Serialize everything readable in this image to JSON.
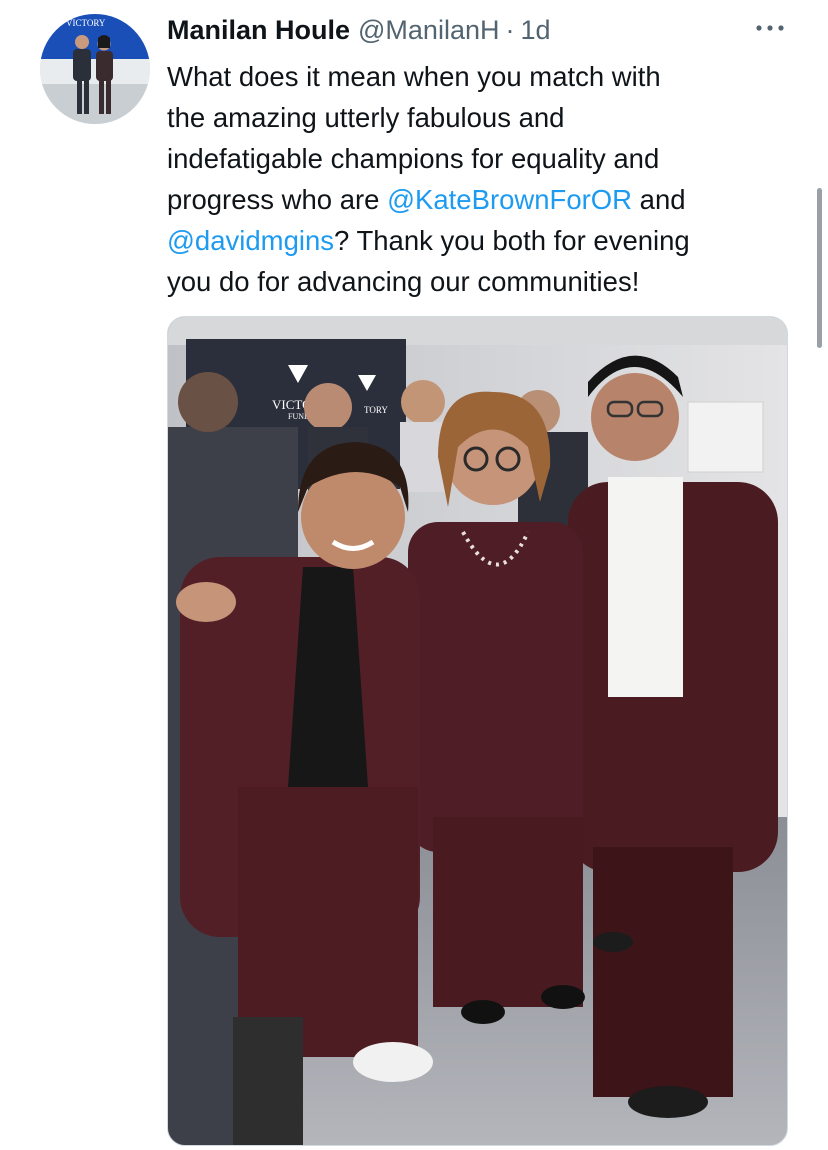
{
  "tweet": {
    "author_name": "Manilan Houle",
    "author_handle": "@ManilanH",
    "separator": "·",
    "timestamp": "1d",
    "more_icon": "more-horizontal-icon",
    "text": {
      "line1": "What does it mean when you match with",
      "line2": "the amazing utterly fabulous and",
      "line3": "indefatigable champions for equality and",
      "line4_a": "progress who are ",
      "mention1": "@KateBrownForOR",
      "line4_b": " and",
      "mention2": "@davidmgins",
      "line5_b": "? Thank you both for evening",
      "line6": "you do for advancing our communities!"
    }
  },
  "avatar": {
    "sign_text": "VICTORY"
  },
  "photo": {
    "sign_text_1": "VICTO",
    "sign_text_2": "FUND",
    "sign_text_3": "TORY"
  },
  "colors": {
    "link": "#1d9bf0",
    "secondary_text": "#536471",
    "suit": "#5a2027"
  }
}
